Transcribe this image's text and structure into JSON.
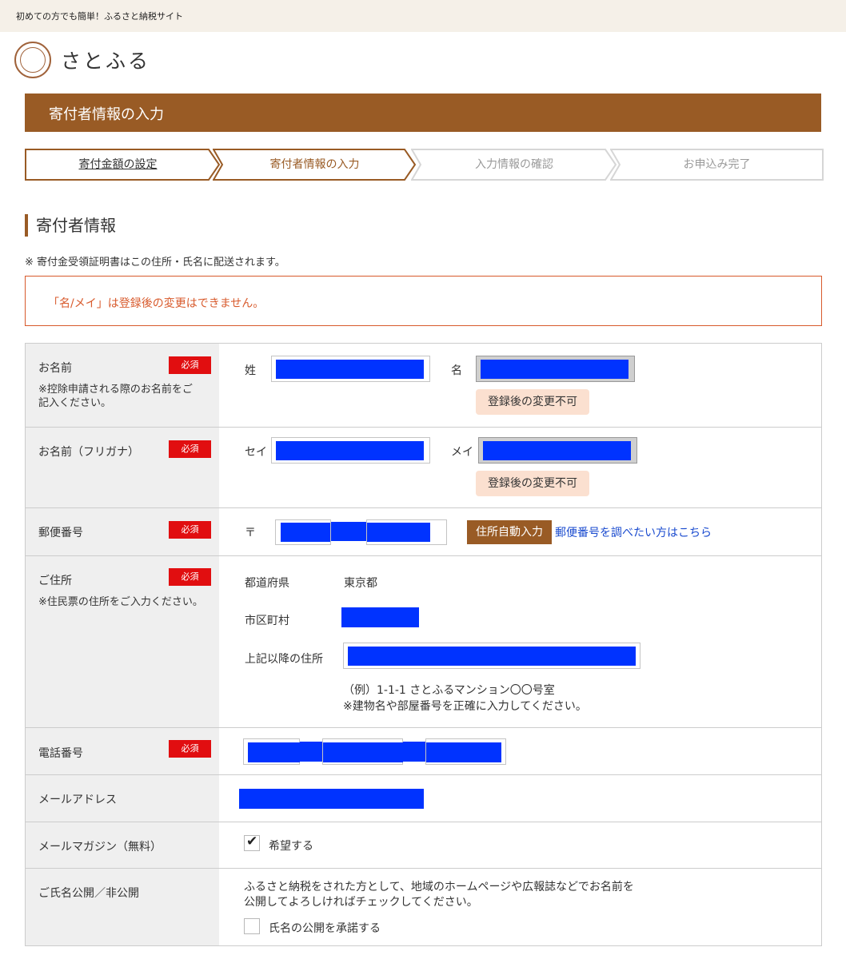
{
  "header": {
    "tagline": "初めての方でも簡単！ふるさと納税サイト",
    "logo_mark_text": "さとふる",
    "logo_name": "さとふる"
  },
  "page_title": "寄付者情報の入力",
  "steps": [
    {
      "label": "寄付金額の設定",
      "state": "done"
    },
    {
      "label": "寄付者情報の入力",
      "state": "current"
    },
    {
      "label": "入力情報の確認",
      "state": "upcoming"
    },
    {
      "label": "お申込み完了",
      "state": "upcoming"
    }
  ],
  "section": {
    "heading": "寄付者情報",
    "note": "※ 寄付金受領証明書はこの住所・氏名に配送されます。",
    "warning": "「名/メイ」は登録後の変更はできません。"
  },
  "required_label": "必須",
  "fields": {
    "name": {
      "label": "お名前",
      "sub": "※控除申請される際のお名前をご記入ください。",
      "last_label": "姓",
      "first_label": "名",
      "locked_tag": "登録後の変更不可"
    },
    "kana": {
      "label": "お名前（フリガナ）",
      "last_label": "セイ",
      "first_label": "メイ",
      "locked_tag": "登録後の変更不可"
    },
    "postal": {
      "label": "郵便番号",
      "prefix": "〒",
      "auto_button": "住所自動入力",
      "lookup_link": "郵便番号を調べたい方はこちら"
    },
    "address": {
      "label": "ご住所",
      "sub": "※住民票の住所をご入力ください。",
      "prefecture_label": "都道府県",
      "prefecture_value": "東京都",
      "city_label": "市区町村",
      "street_label": "上記以降の住所",
      "example": "（例）1-1-1 さとふるマンション〇〇号室",
      "example_note": "※建物名や部屋番号を正確に入力してください。"
    },
    "phone": {
      "label": "電話番号"
    },
    "email": {
      "label": "メールアドレス"
    },
    "magazine": {
      "label": "メールマガジン（無料）",
      "option": "希望する",
      "checked": true
    },
    "publish": {
      "label": "ご氏名公開／非公開",
      "description_line1": "ふるさと納税をされた方として、地域のホームページや広報誌などでお名前を",
      "description_line2": "公開してよろしければチェックしてください。",
      "option": "氏名の公開を承諾する",
      "checked": false
    }
  },
  "colors": {
    "brand": "#995b25",
    "warning": "#d85a2c",
    "required": "#e10e10",
    "redaction": "#0033ff",
    "link": "#1a4bcf"
  }
}
